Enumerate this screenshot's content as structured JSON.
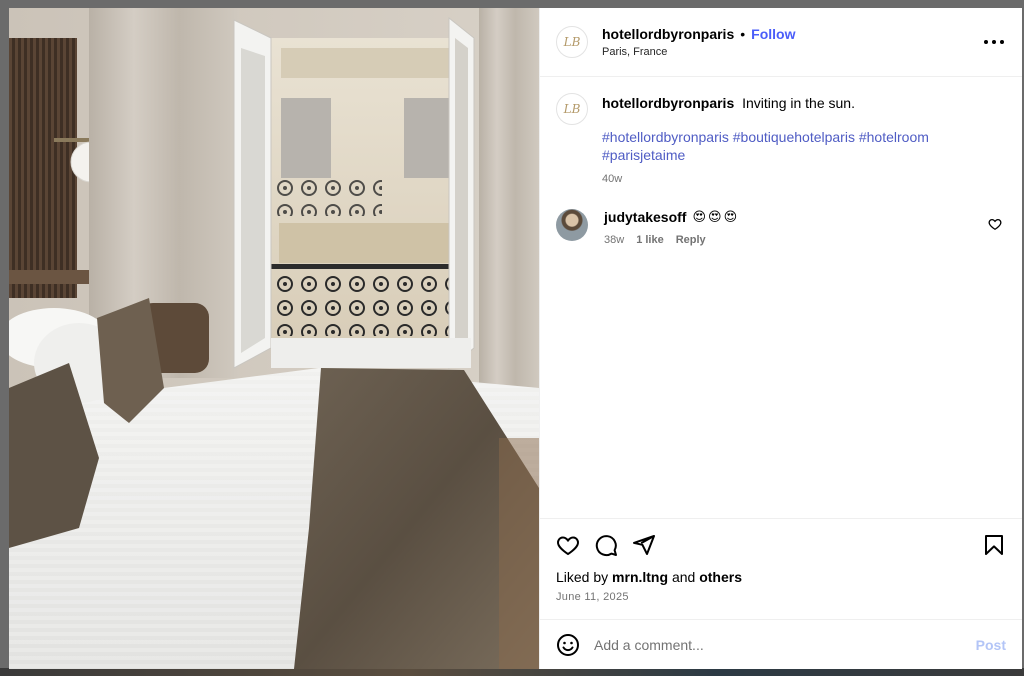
{
  "post": {
    "account": {
      "username": "hotellordbyronparis",
      "location": "Paris, France",
      "follow_label": "Follow",
      "separator": "•",
      "avatar_glyph": "LB"
    },
    "caption": {
      "text": "Inviting in the sun.",
      "hashtags": [
        "#hotellordbyronparis",
        "#boutiquehotelparis",
        "#hotelroom",
        "#parisjetaime"
      ],
      "age": "40w"
    },
    "comments": [
      {
        "username": "judytakesoff",
        "text": "😍😍😍",
        "age": "38w",
        "likes": "1 like",
        "reply_label": "Reply"
      }
    ],
    "liked_by": {
      "prefix": "Liked by",
      "user": "mrn.ltng",
      "conj": "and",
      "others": "others"
    },
    "date": "June 11, 2025",
    "add_comment": {
      "placeholder": "Add a comment...",
      "post_label": "Post"
    }
  },
  "icons": {
    "more": "more-horizontal-icon",
    "like": "heart-icon",
    "comment": "comment-icon",
    "share": "send-icon",
    "save": "bookmark-icon",
    "emoji": "emoji-icon"
  },
  "colors": {
    "accent": "#4a5df9",
    "hashtag": "#4f5cc4",
    "muted": "#737373",
    "post_disabled": "#b3c5f7"
  }
}
